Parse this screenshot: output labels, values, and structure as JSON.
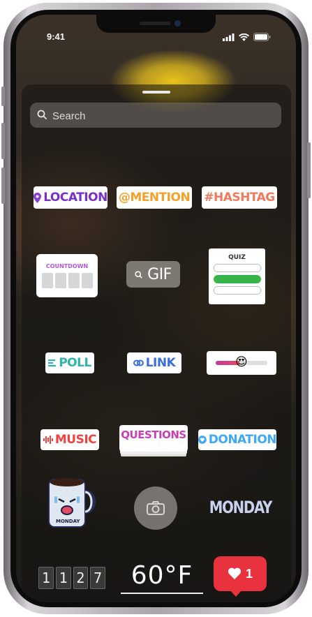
{
  "status_bar": {
    "time": "9:41"
  },
  "search": {
    "placeholder": "Search"
  },
  "stickers": {
    "location": "LOCATION",
    "mention": "@MENTION",
    "hashtag": "#HASHTAG",
    "countdown": "COUNTDOWN",
    "gif": "GIF",
    "quiz": "QUIZ",
    "poll": "POLL",
    "link": "LINK",
    "slider_emoji": "😍",
    "music": "MUSIC",
    "questions": "QUESTIONS",
    "donation": "DONATION",
    "mug_text": "MONDAY",
    "monday": "MONDAY",
    "clock_digits": [
      "1",
      "1",
      "2",
      "7"
    ],
    "temperature": "60°F",
    "likes_count": "1"
  },
  "colors": {
    "location": "#7b2fc9",
    "mention": "#f4a12a",
    "hashtag": "#ef7a5c",
    "poll": "#2fb5a8",
    "link": "#3a6fd8",
    "music": "#f0433f",
    "questions": "#c83fb8",
    "donation": "#3fa9f5",
    "quiz_green": "#38b54a",
    "like_badge": "#e8333e"
  }
}
